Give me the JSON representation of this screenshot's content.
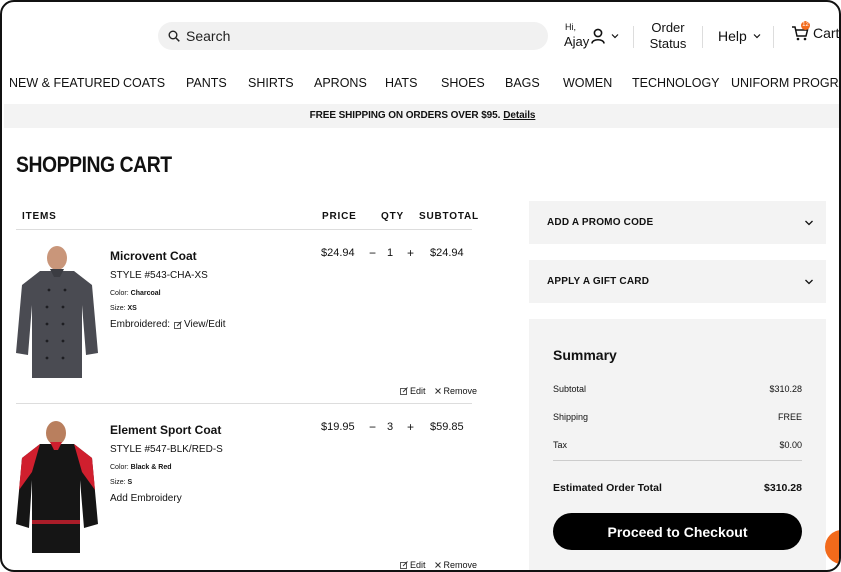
{
  "header": {
    "search_placeholder": "Search",
    "greeting": "Hi,",
    "user_name": "Ajay",
    "order_status_line1": "Order",
    "order_status_line2": "Status",
    "help_label": "Help",
    "cart_label": "Cart",
    "cart_count": "12"
  },
  "nav": {
    "items": [
      "NEW & FEATURED",
      "COATS",
      "PANTS",
      "SHIRTS",
      "APRONS",
      "HATS",
      "SHOES",
      "BAGS",
      "WOMEN",
      "TECHNOLOGY",
      "UNIFORM PROGRAMS"
    ]
  },
  "promo_bar": {
    "message": "FREE SHIPPING ON ORDERS OVER $95.",
    "link": "Details"
  },
  "page": {
    "title": "SHOPPING CART"
  },
  "table": {
    "col_items": "ITEMS",
    "col_price": "PRICE",
    "col_qty": "QTY",
    "col_subtotal": "SUBTOTAL"
  },
  "items": [
    {
      "name": "Microvent Coat",
      "style": "STYLE #543-CHA-XS",
      "color_label": "Color:",
      "color": "Charcoal",
      "size_label": "Size:",
      "size": "XS",
      "embroidery_label": "Embroidered:",
      "embroidery_action": "View/Edit",
      "price": "$24.94",
      "qty_minus": "−",
      "qty": "1",
      "qty_plus": "+",
      "subtotal": "$24.94",
      "edit": "Edit",
      "remove": "Remove"
    },
    {
      "name": "Element Sport Coat",
      "style": "STYLE #547-BLK/RED-S",
      "color_label": "Color:",
      "color": "Black & Red",
      "size_label": "Size:",
      "size": "S",
      "embroidery_label": "Add Embroidery",
      "price": "$19.95",
      "qty_minus": "−",
      "qty": "3",
      "qty_plus": "+",
      "subtotal": "$59.85",
      "edit": "Edit",
      "remove": "Remove"
    }
  ],
  "sidebar": {
    "promo_code": "ADD A PROMO CODE",
    "gift_card": "APPLY A GIFT CARD"
  },
  "summary": {
    "title": "Summary",
    "subtotal_label": "Subtotal",
    "subtotal": "$310.28",
    "shipping_label": "Shipping",
    "shipping": "FREE",
    "tax_label": "Tax",
    "tax": "$0.00",
    "total_label": "Estimated Order Total",
    "total": "$310.28",
    "checkout": "Proceed to Checkout"
  },
  "colors": {
    "accent": "#f26a1b",
    "panel_bg": "#f3f3f3",
    "button_bg": "#000000",
    "coat1": "#4a4b52",
    "coat2_main": "#151515",
    "coat2_trim": "#d01f2e"
  }
}
